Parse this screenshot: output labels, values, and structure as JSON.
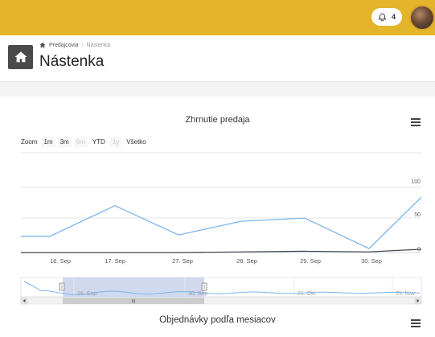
{
  "topbar": {
    "notification_count": "4",
    "bell_icon": "bell-icon",
    "colors": {
      "bar": "#e4b42a"
    }
  },
  "header": {
    "breadcrumb": {
      "home": "Predajcovia",
      "separator": "/",
      "current": "Nástenka"
    },
    "title": "Nástenka"
  },
  "card": {
    "title": "Zhrnutie predaja",
    "zoom": {
      "label": "Zoom",
      "buttons": [
        {
          "label": "1m",
          "state": "normal"
        },
        {
          "label": "3m",
          "state": "normal"
        },
        {
          "label": "6m",
          "state": "disabled"
        },
        {
          "label": "YTD",
          "state": "plain"
        },
        {
          "label": "1y",
          "state": "disabled"
        },
        {
          "label": "Všetko",
          "state": "plain"
        }
      ]
    },
    "second_title": "Objednávky podľa mesiacov"
  },
  "chart_data": {
    "type": "line",
    "x_ticks": [
      "16. Sep",
      "17. Sep",
      "27. Sep",
      "28. Sep",
      "29. Sep",
      "30. Sep"
    ],
    "y_ticks": [
      "100",
      "50",
      "0"
    ],
    "ylim": [
      0,
      100
    ],
    "series": [
      {
        "color": "#7cb5ec",
        "values": [
          25,
          25,
          72,
          27,
          48,
          53,
          6,
          85
        ]
      },
      {
        "color": "#434348",
        "values": [
          0,
          0,
          0,
          0,
          1,
          2,
          1,
          5
        ]
      }
    ],
    "navigator": {
      "labels": [
        "16. Sep",
        "30. Sep",
        "21. Okt",
        "25. Nov"
      ],
      "scroll_thumb_label": "III"
    }
  }
}
